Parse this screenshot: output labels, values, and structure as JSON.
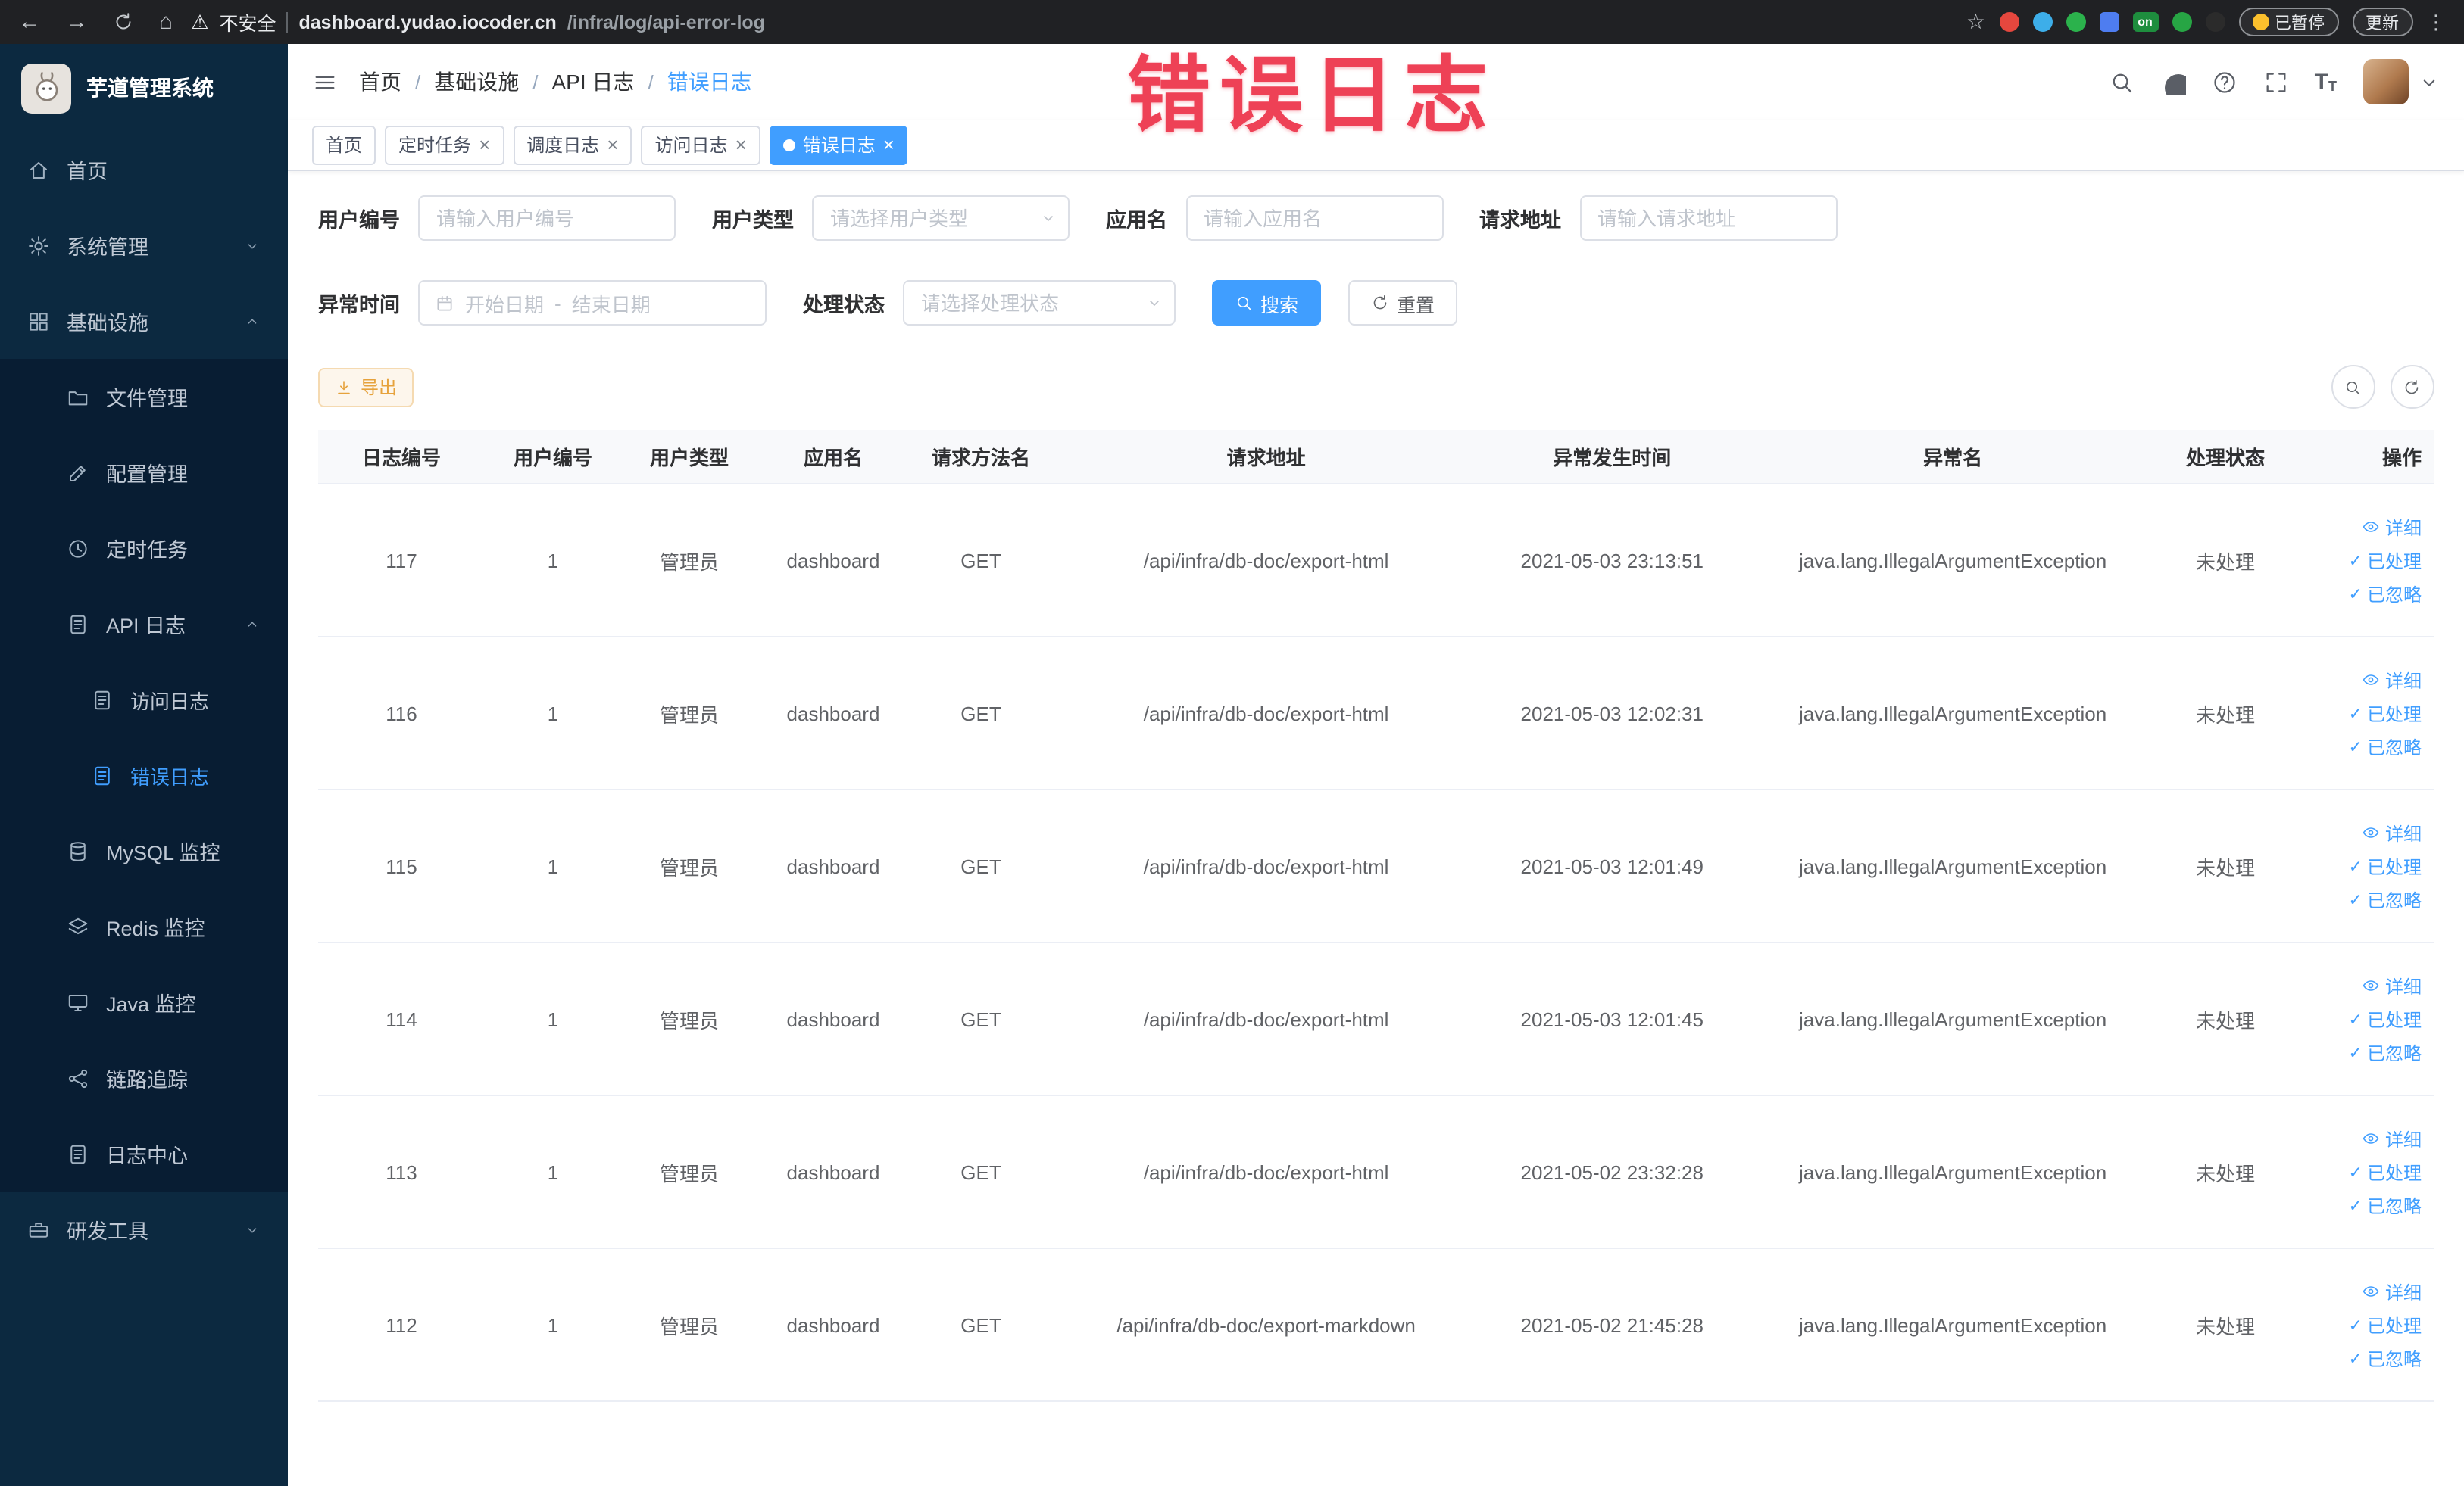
{
  "colors": {
    "accent": "#409eff",
    "annotation_red": "#ee4156",
    "warning": "#e6a23c",
    "sidebar_bg": "#0c2940"
  },
  "icons": {
    "back": "left-arrow",
    "forward": "right-arrow",
    "reload": "circular-arrow",
    "home": "house",
    "warning": "triangle-exclamation",
    "bookmark": "star-outline",
    "menu": "vertical-dots",
    "search": "magnifier",
    "github": "octocat-circle",
    "help": "question-circle",
    "fullscreen": "expand-corners",
    "font-size": "double-T",
    "detail": "eye",
    "done": "check",
    "calendar": "calendar-grid",
    "export": "download-arrow",
    "refresh": "circular-arrow"
  },
  "browser": {
    "security_label": "不安全",
    "url_host": "dashboard.yudao.iocoder.cn",
    "url_path": "/infra/log/api-error-log",
    "extension_badge": "on",
    "paused_label": "已暂停",
    "update_label": "更新"
  },
  "annotation": {
    "text": "错误日志"
  },
  "sidebar": {
    "app_title": "芋道管理系统",
    "items": {
      "home": "首页",
      "system": "系统管理",
      "infra": "基础设施",
      "file": "文件管理",
      "config": "配置管理",
      "job": "定时任务",
      "api_log": "API 日志",
      "access_log": "访问日志",
      "error_log": "错误日志",
      "mysql": "MySQL 监控",
      "redis": "Redis 监控",
      "java": "Java 监控",
      "trace": "链路追踪",
      "log_center": "日志中心",
      "dev_tools": "研发工具"
    }
  },
  "header": {
    "breadcrumb": [
      "首页",
      "基础设施",
      "API 日志",
      "错误日志"
    ]
  },
  "tabs": [
    {
      "label": "首页"
    },
    {
      "label": "定时任务"
    },
    {
      "label": "调度日志"
    },
    {
      "label": "访问日志"
    },
    {
      "label": "错误日志"
    }
  ],
  "filters": {
    "user_id_label": "用户编号",
    "user_id_placeholder": "请输入用户编号",
    "user_type_label": "用户类型",
    "user_type_placeholder": "请选择用户类型",
    "app_name_label": "应用名",
    "app_name_placeholder": "请输入应用名",
    "request_url_label": "请求地址",
    "request_url_placeholder": "请输入请求地址",
    "exception_time_label": "异常时间",
    "date_start_placeholder": "开始日期",
    "date_separator": "-",
    "date_end_placeholder": "结束日期",
    "process_status_label": "处理状态",
    "process_status_placeholder": "请选择处理状态",
    "search_label": "搜索",
    "reset_label": "重置"
  },
  "toolbar": {
    "export_label": "导出"
  },
  "table": {
    "columns": [
      "日志编号",
      "用户编号",
      "用户类型",
      "应用名",
      "请求方法名",
      "请求地址",
      "异常发生时间",
      "异常名",
      "处理状态",
      "操作"
    ],
    "actions": {
      "detail": "详细",
      "processed": "已处理",
      "ignored": "已忽略"
    },
    "rows": [
      {
        "id": "117",
        "user_id": "1",
        "user_type": "管理员",
        "app": "dashboard",
        "method": "GET",
        "url": "/api/infra/db-doc/export-html",
        "time": "2021-05-03 23:13:51",
        "exception": "java.lang.IllegalArgumentException",
        "status": "未处理"
      },
      {
        "id": "116",
        "user_id": "1",
        "user_type": "管理员",
        "app": "dashboard",
        "method": "GET",
        "url": "/api/infra/db-doc/export-html",
        "time": "2021-05-03 12:02:31",
        "exception": "java.lang.IllegalArgumentException",
        "status": "未处理"
      },
      {
        "id": "115",
        "user_id": "1",
        "user_type": "管理员",
        "app": "dashboard",
        "method": "GET",
        "url": "/api/infra/db-doc/export-html",
        "time": "2021-05-03 12:01:49",
        "exception": "java.lang.IllegalArgumentException",
        "status": "未处理"
      },
      {
        "id": "114",
        "user_id": "1",
        "user_type": "管理员",
        "app": "dashboard",
        "method": "GET",
        "url": "/api/infra/db-doc/export-html",
        "time": "2021-05-03 12:01:45",
        "exception": "java.lang.IllegalArgumentException",
        "status": "未处理"
      },
      {
        "id": "113",
        "user_id": "1",
        "user_type": "管理员",
        "app": "dashboard",
        "method": "GET",
        "url": "/api/infra/db-doc/export-html",
        "time": "2021-05-02 23:32:28",
        "exception": "java.lang.IllegalArgumentException",
        "status": "未处理"
      },
      {
        "id": "112",
        "user_id": "1",
        "user_type": "管理员",
        "app": "dashboard",
        "method": "GET",
        "url": "/api/infra/db-doc/export-markdown",
        "time": "2021-05-02 21:45:28",
        "exception": "java.lang.IllegalArgumentException",
        "status": "未处理"
      }
    ]
  }
}
